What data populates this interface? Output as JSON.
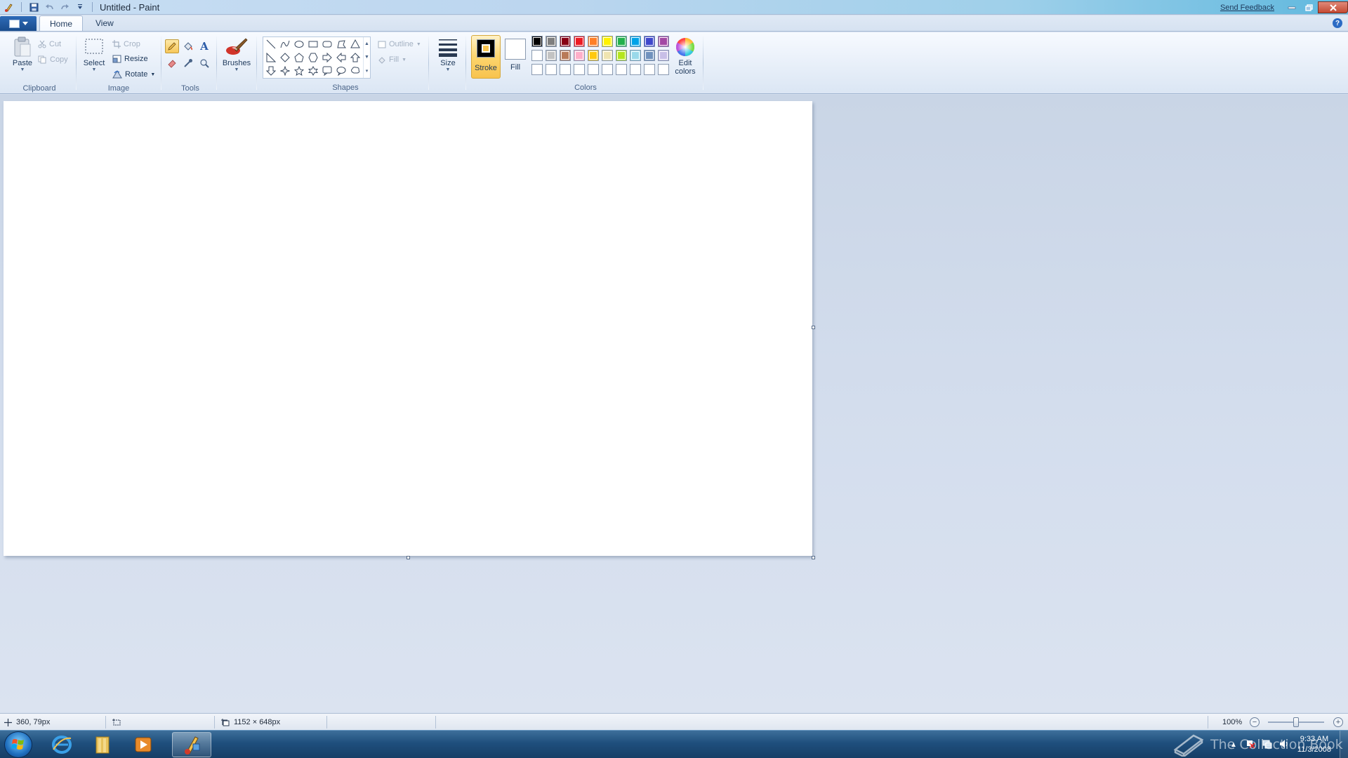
{
  "window": {
    "title": "Untitled - Paint",
    "send_feedback": "Send Feedback"
  },
  "quick_access": {
    "icons": [
      "paint-app-icon",
      "save-icon",
      "undo-icon",
      "redo-icon",
      "customize-qat-icon"
    ]
  },
  "tabs": [
    {
      "label": "Home",
      "active": true
    },
    {
      "label": "View",
      "active": false
    }
  ],
  "ribbon": {
    "clipboard": {
      "label": "Clipboard",
      "paste": "Paste",
      "cut": "Cut",
      "copy": "Copy"
    },
    "image": {
      "label": "Image",
      "select": "Select",
      "crop": "Crop",
      "resize": "Resize",
      "rotate": "Rotate"
    },
    "tools": {
      "label": "Tools"
    },
    "brushes": {
      "label": "Brushes"
    },
    "shapes": {
      "label": "Shapes",
      "outline": "Outline",
      "fill": "Fill"
    },
    "size": {
      "label": "Size"
    },
    "colors": {
      "label": "Colors",
      "stroke": "Stroke",
      "fill": "Fill",
      "edit_colors_line1": "Edit",
      "edit_colors_line2": "colors",
      "stroke_color": "#000000",
      "fill_color": "#ffffff",
      "palette_row1": [
        "#000000",
        "#7f7f7f",
        "#880015",
        "#ed1c24",
        "#ff7f27",
        "#fff200",
        "#22b14c",
        "#00a2e8",
        "#3f48cc",
        "#a349a4"
      ],
      "palette_row2": [
        "#ffffff",
        "#c3c3c3",
        "#b97a57",
        "#ffaec9",
        "#ffc90e",
        "#efe4b0",
        "#b5e61d",
        "#99d9ea",
        "#7092be",
        "#c8bfe7"
      ],
      "palette_row3": [
        "#ffffff",
        "#ffffff",
        "#ffffff",
        "#ffffff",
        "#ffffff",
        "#ffffff",
        "#ffffff",
        "#ffffff",
        "#ffffff",
        "#ffffff"
      ]
    }
  },
  "status": {
    "cursor_position": "360, 79px",
    "selection_size": "",
    "image_size": "1152 × 648px",
    "zoom": "100%",
    "zoom_fraction": 0.5
  },
  "taskbar": {
    "items": [
      "start-button",
      "internet-explorer",
      "windows-explorer",
      "media-player",
      "paint"
    ],
    "active_item": "paint",
    "time": "9:33 AM",
    "date": "11/3/2008",
    "watermark": "The Collection Book"
  }
}
